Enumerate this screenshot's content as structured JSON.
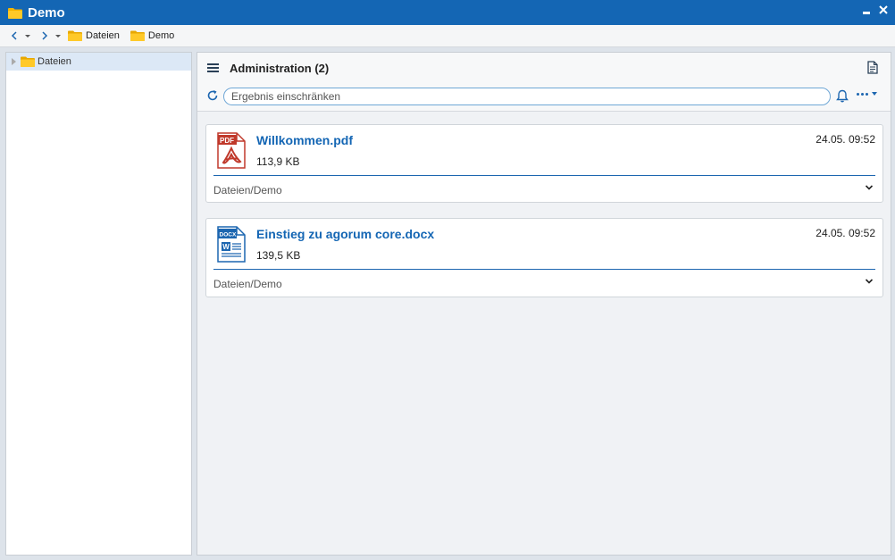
{
  "window": {
    "title": "Demo"
  },
  "breadcrumb": {
    "items": [
      "Dateien",
      "Demo"
    ]
  },
  "tree": {
    "items": [
      {
        "label": "Dateien"
      }
    ]
  },
  "panel": {
    "title": "Administration (2)",
    "filter": {
      "value": "",
      "placeholder": "Ergebnis einschränken"
    }
  },
  "files": [
    {
      "name": "Willkommen.pdf",
      "size": "113,9 KB",
      "date": "24.05. 09:52",
      "path": [
        "Dateien",
        "Demo"
      ],
      "type_label": "PDF",
      "icon": "pdf-file-icon"
    },
    {
      "name": "Einstieg zu agorum core.docx",
      "size": "139,5 KB",
      "date": "24.05. 09:52",
      "path": [
        "Dateien",
        "Demo"
      ],
      "type_label": "DOCX",
      "icon": "docx-file-icon"
    }
  ],
  "colors": {
    "titlebar": "#1466b4",
    "accent": "#1466b4",
    "folder": "#f5b400",
    "pdf": "#c0392b"
  }
}
